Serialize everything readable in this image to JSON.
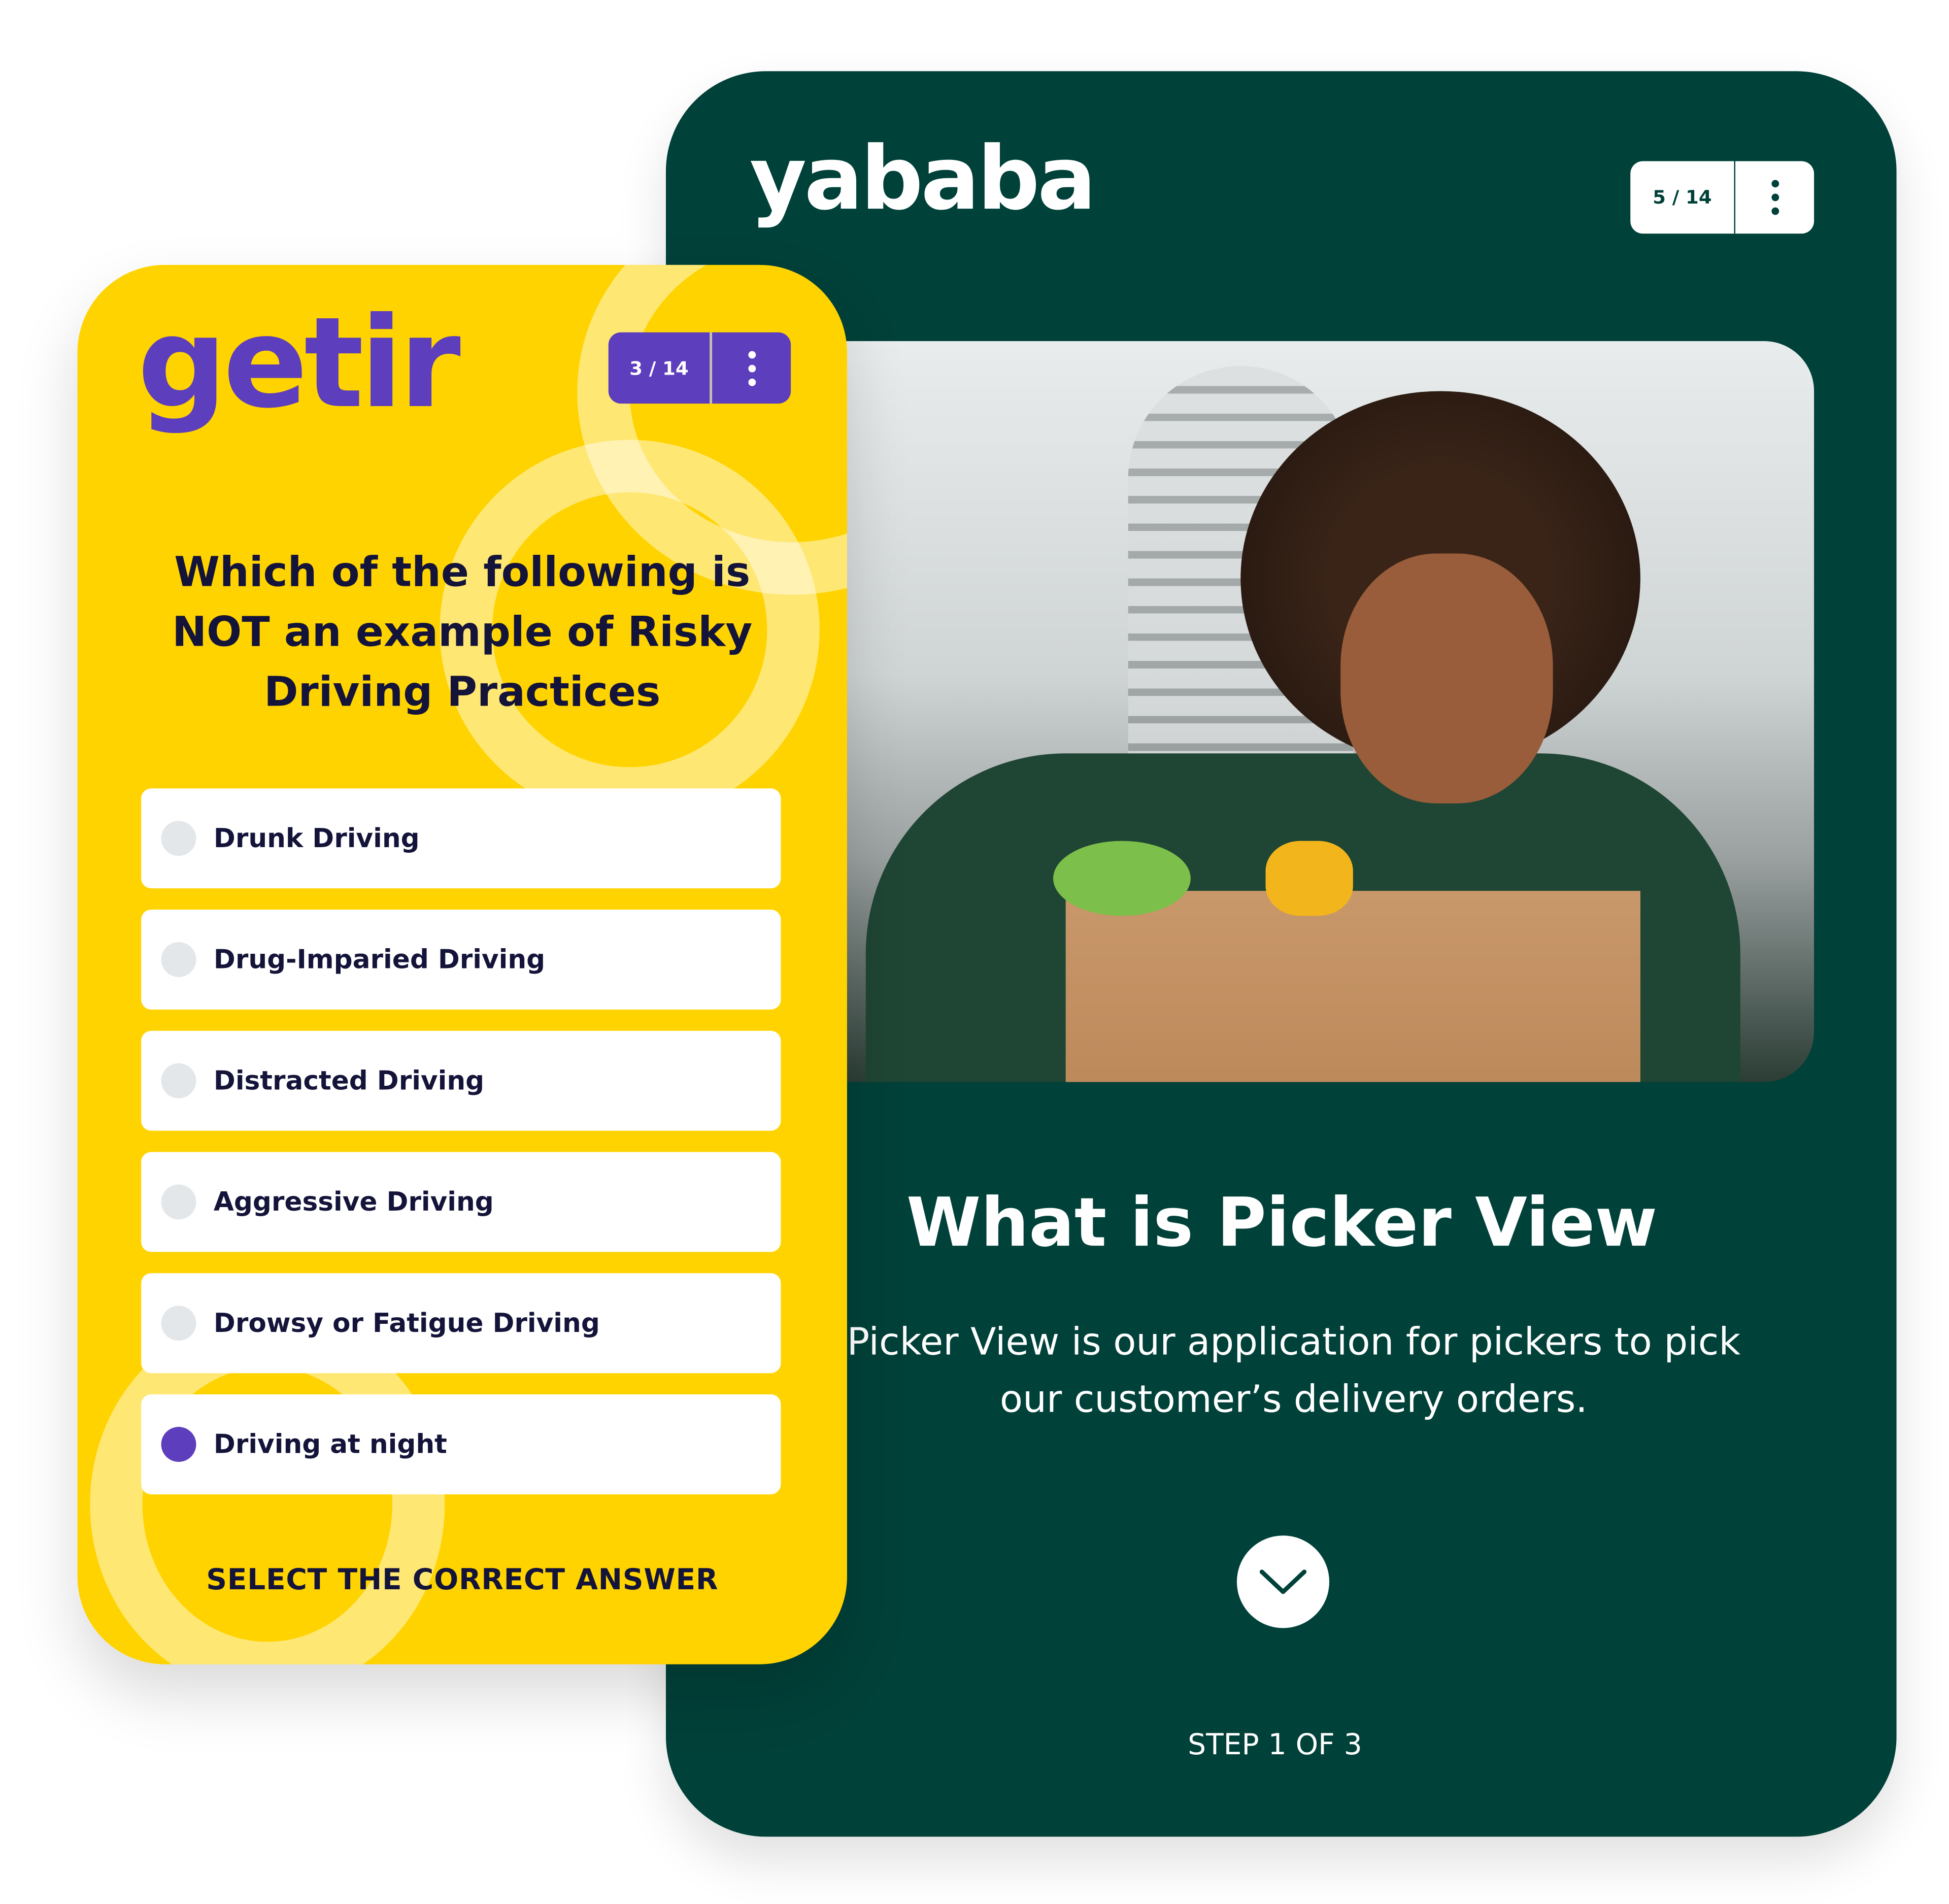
{
  "colors": {
    "dark": "#004139",
    "yellow": "#FFD300",
    "purple": "#5D3EBC"
  },
  "yababa": {
    "logo": "yababa",
    "counter": "5 / 14",
    "menu_icon": "kebab-menu-icon",
    "title": "What is Picker View",
    "description": "Picker View is our application for pickers to pick our customer’s delivery orders.",
    "next_icon": "chevron-down-icon",
    "step": "STEP 1 OF 3"
  },
  "getir": {
    "logo": "getir",
    "counter": "3 / 14",
    "menu_icon": "kebab-menu-icon",
    "question": "Which of the following is NOT an example of Risky Driving Practices",
    "options": [
      {
        "label": "Drunk Driving",
        "selected": false
      },
      {
        "label": "Drug-Imparied Driving",
        "selected": false
      },
      {
        "label": "Distracted Driving",
        "selected": false
      },
      {
        "label": "Aggressive Driving",
        "selected": false
      },
      {
        "label": "Drowsy or Fatigue Driving",
        "selected": false
      },
      {
        "label": "Driving at night",
        "selected": true
      }
    ],
    "hint": "SELECT THE CORRECT ANSWER"
  }
}
